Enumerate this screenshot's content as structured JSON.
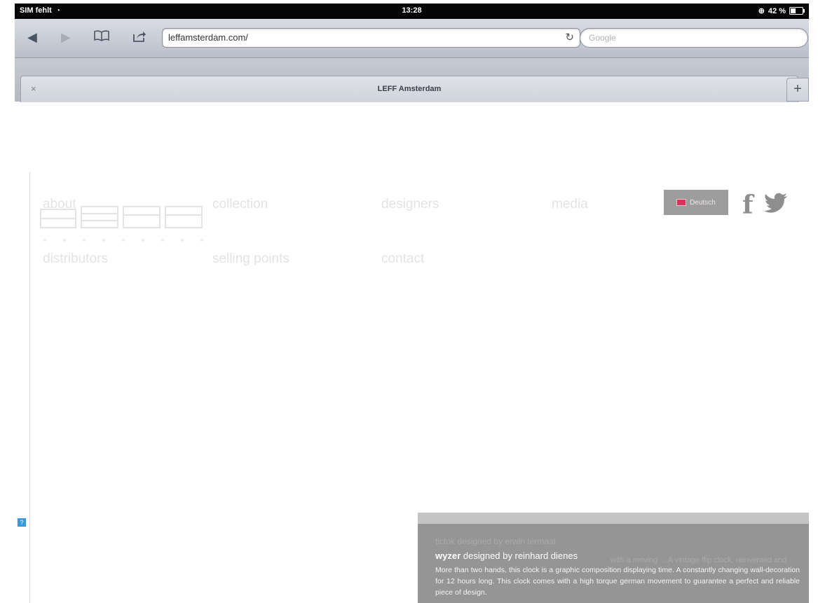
{
  "status_bar": {
    "carrier": "SIM fehlt",
    "time": "13:28",
    "battery_percent": "42 %",
    "battery_level": 0.42
  },
  "browser": {
    "url": "leffamsterdam.com/",
    "search_placeholder": "Google",
    "tab_title": "LEFF Amsterdam",
    "tab_close": "×",
    "new_tab": "+"
  },
  "nav": {
    "about": "about",
    "collection": "collection",
    "designers": "designers",
    "media": "media",
    "distributors": "distributors",
    "selling_points": "selling points",
    "contact": "contact"
  },
  "language": {
    "label": "Deutsch"
  },
  "help_badge": "?",
  "social": {
    "facebook": "f"
  },
  "product": {
    "ghost_title": "tictok designed by erwin termaat",
    "ghost_text": "with a moving ... A vintage flip clock, reinvented and",
    "name": "wyzer",
    "designer_text": "designed by reinhard dienes",
    "description": "More than two hands, this clock is a graphic composition displaying time. A constantly changing wall-decoration for 12 hours long. This clock comes with a high torque german movement to guarantee a perfect and reliable piece of design."
  },
  "colors": {
    "status_bar": "#050505",
    "panel": "#959595",
    "accent_blue": "#3a9ad9",
    "flag_red": "#d8345a"
  },
  "icons": [
    "back-arrow-icon",
    "forward-arrow-icon",
    "bookmarks-icon",
    "share-icon",
    "reload-icon",
    "facebook-icon",
    "twitter-icon",
    "wifi-icon",
    "battery-icon"
  ]
}
